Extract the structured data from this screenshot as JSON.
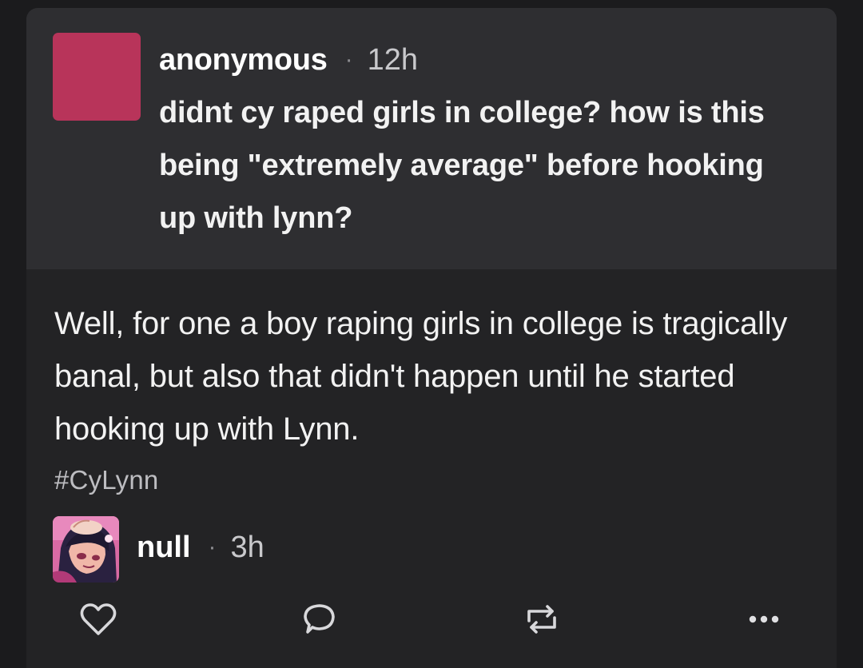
{
  "ask": {
    "asker_name": "anonymous",
    "separator": "·",
    "time": "12h",
    "question": "didnt cy raped girls in college? how is this being \"extremely average\" before hooking up with lynn?"
  },
  "answer": {
    "text": "Well, for one a boy raping girls in college is tragically banal, but also that didn't happen until he started hooking up with Lynn."
  },
  "tags": [
    "#CyLynn"
  ],
  "reblog": {
    "name": "null",
    "separator": "·",
    "time": "3h",
    "avatar_icon": "artwork-avatar"
  },
  "actions": {
    "like_icon": "heart-icon",
    "reply_icon": "comment-icon",
    "reblog_icon": "reblog-icon",
    "more_icon": "more-icon"
  },
  "colors": {
    "background": "#1b1b1d",
    "card": "#232325",
    "ask_panel": "#2e2e31",
    "anon_avatar": "#b8345a"
  }
}
